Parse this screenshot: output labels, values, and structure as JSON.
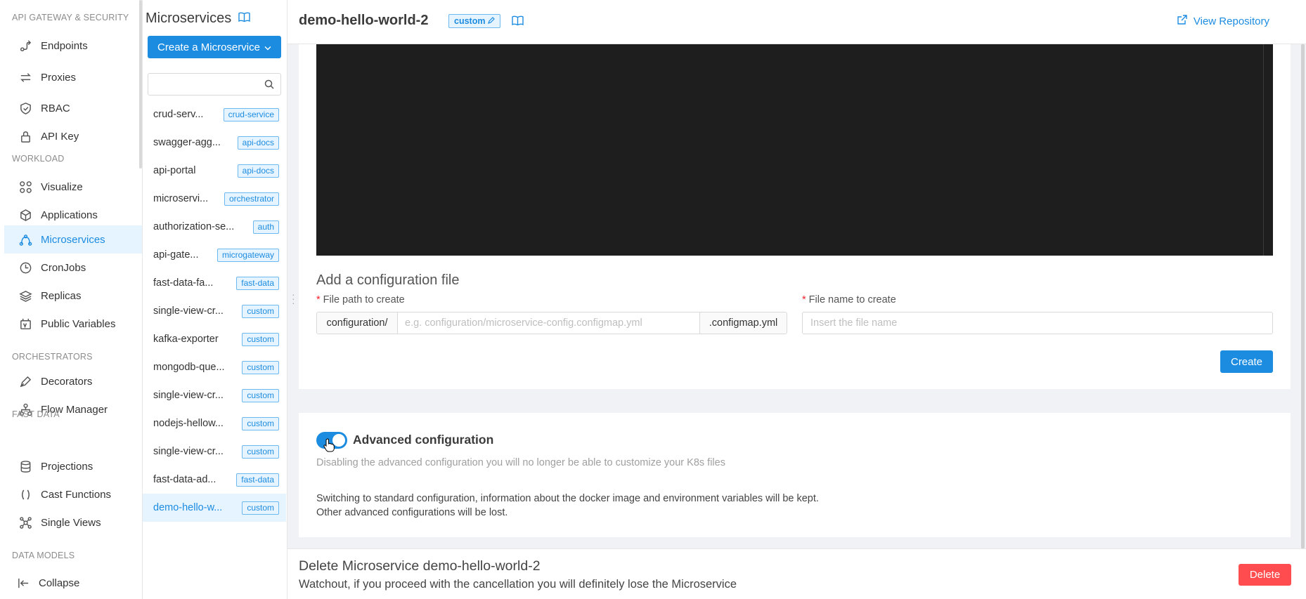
{
  "nav": {
    "sections": [
      {
        "label": "API GATEWAY & SECURITY"
      },
      {
        "label": "WORKLOAD"
      },
      {
        "label": "ORCHESTRATORS"
      },
      {
        "label": "FAST DATA"
      },
      {
        "label": "DATA MODELS"
      }
    ],
    "items": [
      {
        "label": "Endpoints",
        "icon": "endpoint-icon"
      },
      {
        "label": "Proxies",
        "icon": "proxy-icon"
      },
      {
        "label": "RBAC",
        "icon": "shield-icon"
      },
      {
        "label": "API Key",
        "icon": "lock-icon"
      },
      {
        "label": "Visualize",
        "icon": "graph-icon"
      },
      {
        "label": "Applications",
        "icon": "cube-icon"
      },
      {
        "label": "Microservices",
        "icon": "microservice-icon",
        "active": true
      },
      {
        "label": "CronJobs",
        "icon": "clock-icon"
      },
      {
        "label": "Replicas",
        "icon": "layers-icon"
      },
      {
        "label": "Public Variables",
        "icon": "variables-icon"
      },
      {
        "label": "Decorators",
        "icon": "pen-icon"
      },
      {
        "label": "Flow Manager",
        "icon": "flow-icon"
      },
      {
        "label": "Projections",
        "icon": "database-icon"
      },
      {
        "label": "Cast Functions",
        "icon": "parentheses-icon"
      },
      {
        "label": "Single Views",
        "icon": "network-icon"
      }
    ],
    "collapse_label": "Collapse"
  },
  "list": {
    "title": "Microservices",
    "create_label": "Create a Microservice",
    "search_placeholder": "",
    "items": [
      {
        "name": "crud-serv...",
        "tag": "crud-service"
      },
      {
        "name": "swagger-agg...",
        "tag": "api-docs"
      },
      {
        "name": "api-portal",
        "tag": "api-docs"
      },
      {
        "name": "microservi...",
        "tag": "orchestrator"
      },
      {
        "name": "authorization-se...",
        "tag": "auth"
      },
      {
        "name": "api-gate...",
        "tag": "microgateway"
      },
      {
        "name": "fast-data-fa...",
        "tag": "fast-data"
      },
      {
        "name": "single-view-cr...",
        "tag": "custom"
      },
      {
        "name": "kafka-exporter",
        "tag": "custom"
      },
      {
        "name": "mongodb-que...",
        "tag": "custom"
      },
      {
        "name": "single-view-cr...",
        "tag": "custom"
      },
      {
        "name": "nodejs-hellow...",
        "tag": "custom"
      },
      {
        "name": "single-view-cr...",
        "tag": "custom"
      },
      {
        "name": "fast-data-ad...",
        "tag": "fast-data"
      },
      {
        "name": "demo-hello-w...",
        "tag": "custom",
        "active": true
      }
    ]
  },
  "header": {
    "title": "demo-hello-world-2",
    "tag": "custom",
    "view_repo_label": "View Repository"
  },
  "config": {
    "title": "Add a configuration file",
    "path_label": "File path to create",
    "path_prefix": "configuration/",
    "path_placeholder": "e.g. configuration/microservice-config.configmap.yml",
    "path_suffix": ".configmap.yml",
    "name_label": "File name to create",
    "name_placeholder": "Insert the file name",
    "create_label": "Create"
  },
  "advanced": {
    "enabled": true,
    "title": "Advanced configuration",
    "subtitle": "Disabling the advanced configuration you will no longer be able to customize your K8s files",
    "note_line1": "Switching to standard configuration, information about the docker image and environment variables will be kept.",
    "note_line2": "Other advanced configurations will be lost."
  },
  "delete": {
    "title": "Delete Microservice demo-hello-world-2",
    "subtitle": "Watchout, if you proceed with the cancellation you will definitely lose the Microservice",
    "button_label": "Delete"
  },
  "colors": {
    "accent": "#1c8ce0",
    "danger": "#ff4d4f",
    "editor_bg": "#1e1e1e"
  }
}
